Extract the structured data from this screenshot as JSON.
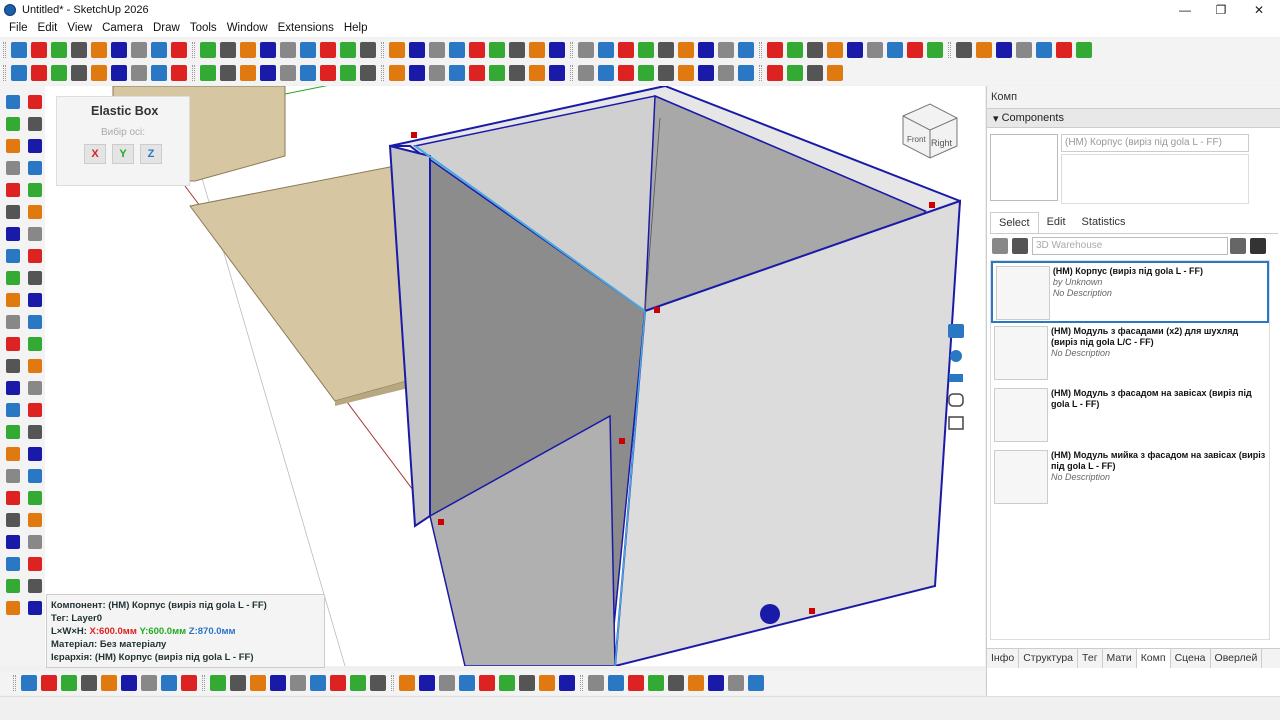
{
  "window": {
    "title": "Untitled* - SketchUp 2026",
    "min": "—",
    "max": "❐",
    "close": "✕"
  },
  "menu": [
    "File",
    "Edit",
    "View",
    "Camera",
    "Draw",
    "Tools",
    "Window",
    "Extensions",
    "Help"
  ],
  "elastic_box": {
    "title": "Elastic Box",
    "hint": "Вибір осі:",
    "x": "X",
    "y": "Y",
    "z": "Z"
  },
  "component_info": {
    "component": "Компонент: (HM) Корпус (виріз під gola L - FF)",
    "tag": "Тег: Layer0",
    "dims_label": "L×W×H: ",
    "dim_x": "X:600.0мм",
    "dim_y": "Y:600.0мм",
    "dim_z": "Z:870.0мм",
    "material": "Матеріал: Без матеріалу",
    "hierarchy": "Ієрархія: (HM) Корпус (виріз під gola L - FF)"
  },
  "panel": {
    "title": "Комп",
    "section": "Components",
    "name_field": "(HM) Корпус (виріз під gola L - FF)",
    "tabs": [
      "Select",
      "Edit",
      "Statistics"
    ],
    "search_placeholder": "3D Warehouse",
    "items": [
      {
        "title": "(HM) Корпус (виріз під gola L - FF)",
        "by": "by Unknown",
        "desc": "No Description"
      },
      {
        "title": "(HM) Модуль з фасадами (x2) для шухляд (виріз під gola L/C - FF)",
        "by": "",
        "desc": "No Description"
      },
      {
        "title": "(HM) Модуль з фасадом на завісах (виріз під gola L - FF)",
        "by": "",
        "desc": ""
      },
      {
        "title": "(HM) Модуль мийка з фасадом на завісах (виріз під gola L - FF)",
        "by": "",
        "desc": "No Description"
      }
    ],
    "bottom_tabs": [
      "Інфо",
      "Структура",
      "Тег",
      "Мати",
      "Комп",
      "Сцена",
      "Оверлей"
    ]
  },
  "viewcube": {
    "front": "Front",
    "right": "Right"
  },
  "colors": {
    "selection_blue": "#1a1aa8",
    "accent_blue": "#2a77c4",
    "wood": "#d6c6a2"
  }
}
